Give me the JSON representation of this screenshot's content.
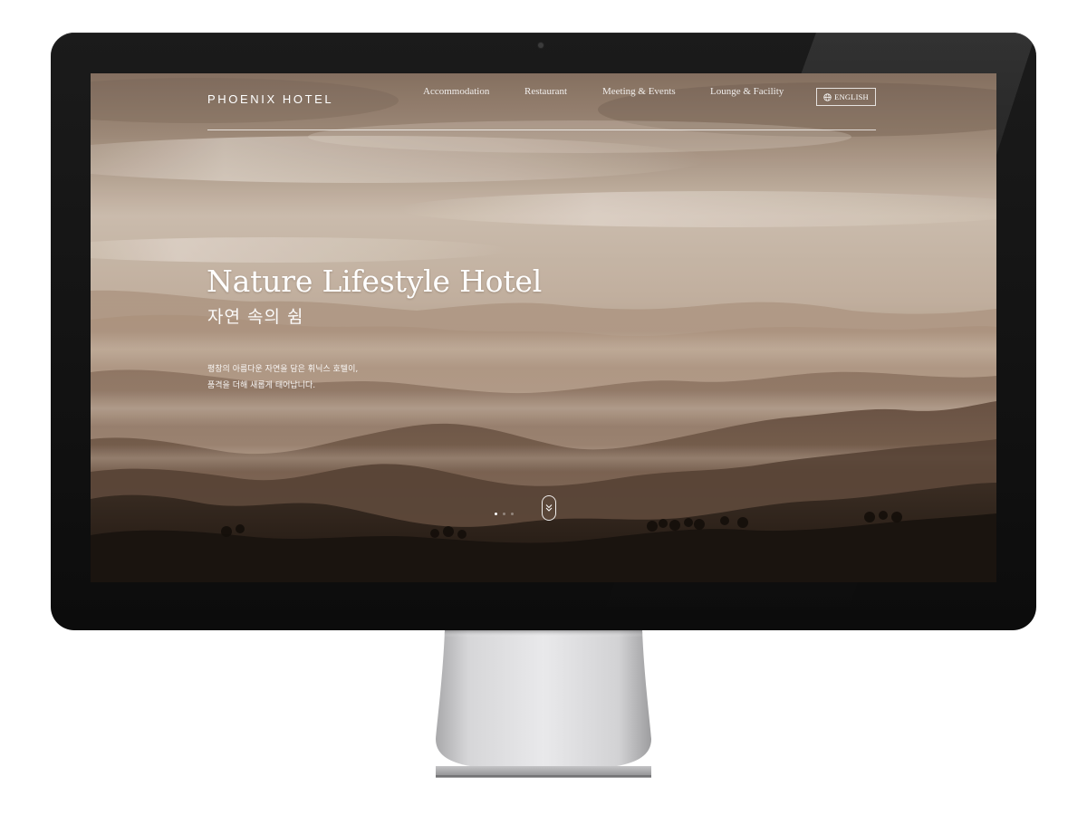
{
  "site": {
    "brand": "PHOENIX HOTEL",
    "nav": [
      {
        "label": "Accommodation"
      },
      {
        "label": "Restaurant"
      },
      {
        "label": "Meeting & Events"
      },
      {
        "label": "Lounge & Facility"
      }
    ],
    "language_button": "ENGLISH",
    "language_icon": "globe-icon"
  },
  "hero": {
    "title": "Nature Lifestyle Hotel",
    "subtitle": "자연 속의 쉼",
    "description_line1": "평창의 아름다운 자연을 담은 휘닉스 호텔이,",
    "description_line2": "품격을 더해 새롭게 태어납니다.",
    "slide_count": 3,
    "active_slide": 1,
    "scroll_icon": "chevron-double-down-icon"
  },
  "colors": {
    "sky_top": "#8c7766",
    "sky_mid": "#d7c8b9",
    "mountain_far": "#b49a85",
    "mountain_mid": "#7e6654",
    "mountain_near": "#2d221b",
    "bezel": "#111111",
    "stand": "#c9c9cb"
  }
}
